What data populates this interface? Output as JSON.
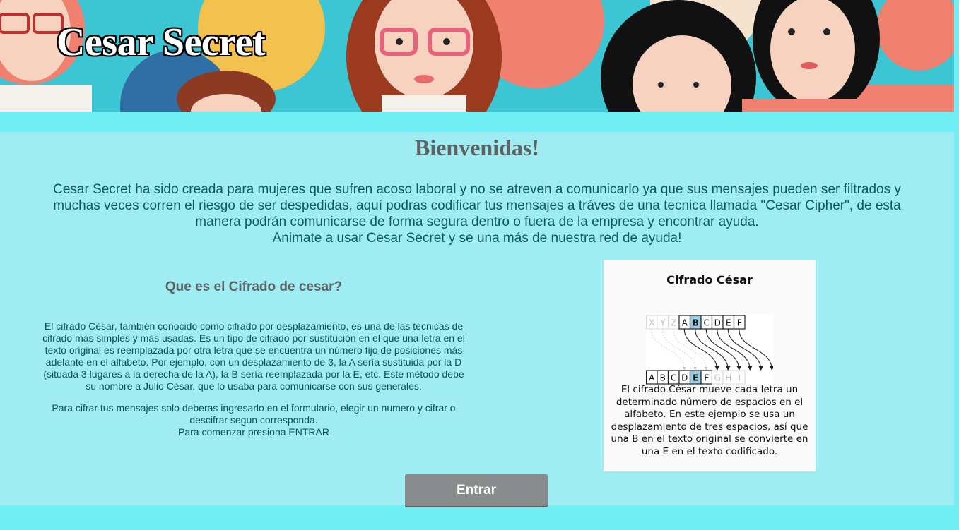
{
  "header": {
    "title": "Cesar Secret"
  },
  "main": {
    "welcome": "Bienvenidas!",
    "intro_lines": [
      "Cesar Secret ha sido creada para mujeres que sufren acoso laboral y no se atreven a comunicarlo ya que sus mensajes pueden ser filtrados y",
      "muchas veces corren el riesgo de ser despedidas, aquí podras codificar tus mensajes a tráves de una tecnica llamada \"Cesar Cipher\", de esta",
      "manera podrán comunicarse de forma segura dentro o fuera de la empresa y encontrar ayuda.",
      "Animate a usar Cesar Secret y se una más de nuestra red de ayuda!"
    ]
  },
  "info": {
    "heading": "Que es el Cifrado de cesar?",
    "paragraph1": "El cifrado César, también conocido como cifrado por desplazamiento, es una de las técnicas de cifrado más simples y más usadas. Es un tipo de cifrado por sustitución en el que una letra en el texto original es reemplazada por otra letra que se encuentra un número fijo de posiciones más adelante en el alfabeto. Por ejemplo, con un desplazamiento de 3, la A sería sustituida por la D (situada 3 lugares a la derecha de la A), la B sería reemplazada por la E, etc. Este método debe su nombre a Julio César, que lo usaba para comunicarse con sus generales.",
    "paragraph2": "Para cifrar tus mensajes solo deberas ingresarlo en el formulario, elegir un numero y cifrar o descifrar segun corresponda.",
    "paragraph3": "Para comenzar presiona ENTRAR"
  },
  "diagram": {
    "title": "Cifrado César",
    "top_row": [
      "X",
      "Y",
      "Z",
      "A",
      "B",
      "C",
      "D",
      "E",
      "F"
    ],
    "bottom_row": [
      "A",
      "B",
      "C",
      "D",
      "E",
      "F",
      "G",
      "H",
      "I"
    ],
    "caption": "El cifrado César mueve cada letra un determinado número de espacios en el alfabeto. En este ejemplo se usa un desplazamiento de tres espacios, así que una B en el texto original se convierte en una E en el texto codificado."
  },
  "actions": {
    "enter_label": "Entrar"
  },
  "colors": {
    "page_background": "#72eef5",
    "panel_background": "#a0ecf3",
    "button": "#888c8c",
    "highlight": "#9ccfe4"
  }
}
